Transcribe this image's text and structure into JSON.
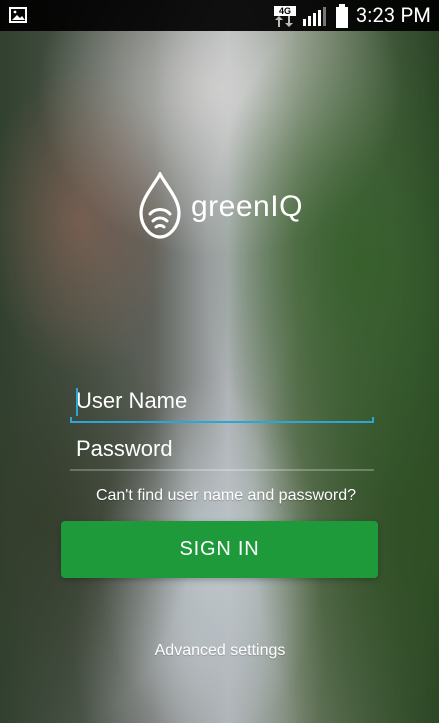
{
  "status_bar": {
    "network": "4G",
    "time": "3:23 PM"
  },
  "branding": {
    "logo_text": "greenIQ"
  },
  "login_form": {
    "username_placeholder": "User Name",
    "password_placeholder": "Password",
    "forgot_text": "Can't find user name and password?",
    "sign_in_label": "SIGN IN",
    "advanced_settings_label": "Advanced settings"
  },
  "colors": {
    "accent_focus": "#2aa7d7",
    "primary_button": "#1f9a3a",
    "text": "#ffffff"
  }
}
